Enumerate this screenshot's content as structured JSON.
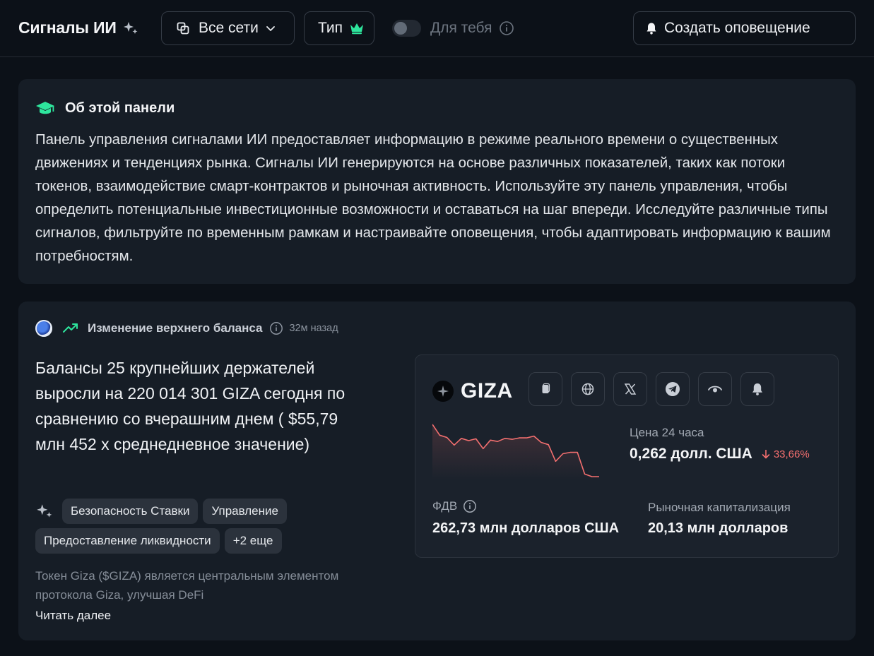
{
  "header": {
    "title": "Сигналы ИИ",
    "networks_label": "Все сети",
    "type_label": "Тип",
    "for_you_label": "Для тебя",
    "create_alert_label": "Создать оповещение"
  },
  "about": {
    "title": "Об этой панели",
    "body": "Панель управления сигналами ИИ предоставляет информацию в режиме реального времени о существенных движениях и тенденциях рынка. Сигналы ИИ генерируются на основе различных показателей, таких как потоки токенов, взаимодействие смарт-контрактов и рыночная активность. Используйте эту панель управления, чтобы определить потенциальные инвестиционные возможности и оставаться на шаг впереди. Исследуйте различные типы сигналов, фильтруйте по временным рамкам и настраивайте оповещения, чтобы адаптировать информацию к вашим потребностям."
  },
  "signal": {
    "type": "Изменение верхнего баланса",
    "time_ago": "32м назад",
    "text": "Балансы 25 крупнейших держателей выросли на 220 014 301 GIZA сегодня по сравнению со вчерашним днем ( $55,79 млн 452 x среднедневное значение)",
    "tags": [
      "Безопасность Ставки",
      "Управление",
      "Предоставление ликвидности"
    ],
    "more_tags": "+2 еще",
    "description": "Токен Giza ($GIZA) является центральным элементом протокола Giza, улучшая DeFi",
    "read_more": "Читать далее"
  },
  "token": {
    "symbol": "GIZA",
    "price_label": "Цена 24 часа",
    "price": "0,262 долл. США",
    "change": "33,66%",
    "change_direction": "down",
    "fdv_label": "ФДВ",
    "fdv": "262,73 млн долларов США",
    "mcap_label": "Рыночная капитализация",
    "mcap": "20,13 млн долларов",
    "sparkline": [
      0.92,
      0.68,
      0.63,
      0.46,
      0.61,
      0.56,
      0.6,
      0.38,
      0.57,
      0.54,
      0.61,
      0.59,
      0.62,
      0.62,
      0.66,
      0.52,
      0.47,
      0.1,
      0.27,
      0.3,
      0.3,
      -0.18,
      -0.24,
      -0.24
    ],
    "icons": [
      "copy-icon",
      "globe-icon",
      "x-icon",
      "telegram-icon",
      "eye-icon",
      "bell-icon"
    ]
  },
  "colors": {
    "background": "#0c1118",
    "panel": "#161d26",
    "accent_green": "#2ee59d",
    "negative": "#f36f6f"
  }
}
